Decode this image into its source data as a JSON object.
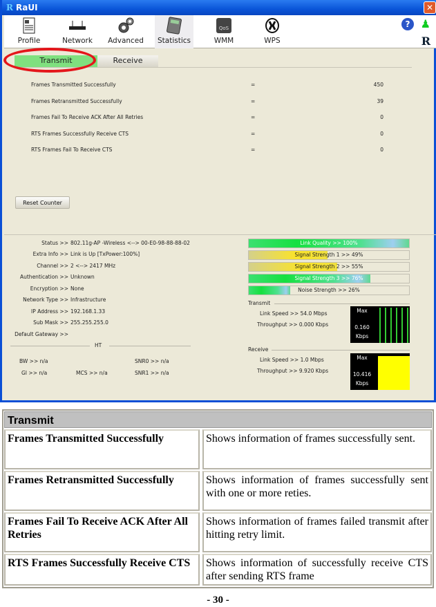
{
  "window": {
    "title": "RaUI",
    "close_label": "✕"
  },
  "toolbar": {
    "items": [
      {
        "label": "Profile",
        "icon": "profile-icon"
      },
      {
        "label": "Network",
        "icon": "network-icon"
      },
      {
        "label": "Advanced",
        "icon": "advanced-icon"
      },
      {
        "label": "Statistics",
        "icon": "statistics-icon",
        "active": true
      },
      {
        "label": "WMM",
        "icon": "wmm-icon"
      },
      {
        "label": "WPS",
        "icon": "wps-icon"
      }
    ],
    "help_label": "?",
    "logo_label": "R"
  },
  "tabs": [
    {
      "label": "Transmit",
      "active": true
    },
    {
      "label": "Receive"
    }
  ],
  "stats": [
    {
      "label": "Frames Transmitted Successfully",
      "eq": "=",
      "value": "450"
    },
    {
      "label": "Frames Retransmitted Successfully",
      "eq": "=",
      "value": "39"
    },
    {
      "label": "Frames Fail To Receive ACK After All Retries",
      "eq": "=",
      "value": "0"
    },
    {
      "label": "RTS Frames Successfully Receive CTS",
      "eq": "=",
      "value": "0"
    },
    {
      "label": "RTS Frames Fail To Receive CTS",
      "eq": "=",
      "value": "0"
    }
  ],
  "reset_label": "Reset Counter",
  "info": [
    {
      "key": "Status >>",
      "value": "802.11g-AP -Wireless  <--> 00-E0-98-88-88-02"
    },
    {
      "key": "Extra Info >>",
      "value": "Link is Up  [TxPower:100%]"
    },
    {
      "key": "Channel >>",
      "value": "2 <--> 2417 MHz"
    },
    {
      "key": "Authentication >>",
      "value": "Unknown"
    },
    {
      "key": "Encryption >>",
      "value": "None"
    },
    {
      "key": "Network Type >>",
      "value": "Infrastructure"
    },
    {
      "key": "IP Address >>",
      "value": "192.168.1.33"
    },
    {
      "key": "Sub Mask >>",
      "value": "255.255.255.0"
    },
    {
      "key": "Default Gateway >>",
      "value": ""
    }
  ],
  "ht": {
    "title": "HT",
    "bw": "BW >> n/a",
    "gi": "GI >> n/a",
    "mcs": "MCS >> n/a",
    "snr0": "SNR0 >> n/a",
    "snr1": "SNR1 >> n/a"
  },
  "signal_bars": [
    {
      "label": "Link Quality >> 100%",
      "percent": 100,
      "kind": "green"
    },
    {
      "label": "Signal Strength 1 >> 49%",
      "percent": 49,
      "kind": "yellow"
    },
    {
      "label": "Signal Strength 2 >> 55%",
      "percent": 55,
      "kind": "yellow"
    },
    {
      "label": "Signal Strength 3 >> 76%",
      "percent": 76,
      "kind": "green"
    },
    {
      "label": "Noise Strength >> 26%",
      "percent": 26,
      "kind": "green"
    }
  ],
  "transmit": {
    "title": "Transmit",
    "link_speed": "Link Speed >>  54.0 Mbps",
    "throughput": "Throughput >> 0.000 Kbps",
    "max_label": "Max",
    "max_value": "0.160",
    "unit": "Kbps"
  },
  "receive": {
    "title": "Receive",
    "link_speed": "Link Speed >>  1.0 Mbps",
    "throughput": "Throughput >> 9.920 Kbps",
    "max_label": "Max",
    "max_value": "10.416",
    "unit": "Kbps"
  },
  "doc": {
    "header": "Transmit",
    "rows": [
      {
        "term": "Frames Transmitted Successfully",
        "desc": "Shows information of frames successfully sent."
      },
      {
        "term": "Frames Retransmitted Successfully",
        "desc": "Shows information of frames successfully sent with one or more reties."
      },
      {
        "term": "Frames Fail To Receive ACK After All Retries",
        "desc": "Shows information of frames failed transmit after hitting retry limit."
      },
      {
        "term": "RTS Frames Successfully Receive CTS",
        "desc": "Shows information of successfully receive CTS after sending RTS frame"
      }
    ],
    "page_number": "- 30 -"
  },
  "colors": {
    "highlight_oval": "#e4161b",
    "active_tab": "#7fe07f",
    "titlebar": "#0a55d8"
  }
}
